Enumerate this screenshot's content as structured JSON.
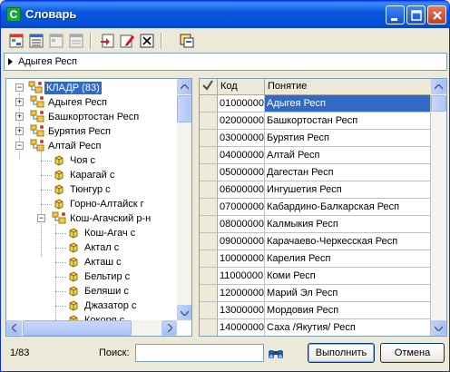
{
  "window": {
    "title": "Словарь"
  },
  "toolbar": {
    "buttons": [
      "tree-add-icon",
      "list-icon",
      "tree-disabled-icon",
      "list-disabled-icon",
      "import-icon",
      "edit-icon",
      "close-box-icon",
      "select-icon"
    ]
  },
  "path": {
    "text": "Адыгея Респ"
  },
  "tree": {
    "root": {
      "label": "КЛАДР (83)"
    },
    "items": [
      {
        "label": "Адыгея Респ",
        "level": 1,
        "expander": "+"
      },
      {
        "label": "Башкортостан Респ",
        "level": 1,
        "expander": "+"
      },
      {
        "label": "Бурятия Респ",
        "level": 1,
        "expander": "+"
      },
      {
        "label": "Алтай Респ",
        "level": 1,
        "expander": "−"
      },
      {
        "label": "Чоя с",
        "level": 2
      },
      {
        "label": "Карагай с",
        "level": 2
      },
      {
        "label": "Тюнгур с",
        "level": 2
      },
      {
        "label": "Горно-Алтайск г",
        "level": 2
      },
      {
        "label": "Кош-Агачский р-н",
        "level": 2,
        "expander": "−"
      },
      {
        "label": "Кош-Агач с",
        "level": 3
      },
      {
        "label": "Актал с",
        "level": 3
      },
      {
        "label": "Акташ с",
        "level": 3
      },
      {
        "label": "Бельтир с",
        "level": 3
      },
      {
        "label": "Беляши с",
        "level": 3
      },
      {
        "label": "Джазатор с",
        "level": 3
      },
      {
        "label": "Кокоря с",
        "level": 3
      }
    ]
  },
  "grid": {
    "columns": [
      "Код",
      "Понятие"
    ],
    "rows": [
      {
        "code": "01000000",
        "name": "Адыгея Респ"
      },
      {
        "code": "02000000",
        "name": "Башкортостан Респ"
      },
      {
        "code": "03000000",
        "name": "Бурятия Респ"
      },
      {
        "code": "04000000",
        "name": "Алтай Респ"
      },
      {
        "code": "05000000",
        "name": "Дагестан Респ"
      },
      {
        "code": "06000000",
        "name": "Ингушетия Респ"
      },
      {
        "code": "07000000",
        "name": "Кабардино-Балкарская Респ"
      },
      {
        "code": "08000000",
        "name": "Калмыкия Респ"
      },
      {
        "code": "09000000",
        "name": "Карачаево-Черкесская Респ"
      },
      {
        "code": "10000000",
        "name": "Карелия Респ"
      },
      {
        "code": "11000000",
        "name": "Коми Респ"
      },
      {
        "code": "12000000",
        "name": "Марий Эл Респ"
      },
      {
        "code": "13000000",
        "name": "Мордовия Респ"
      },
      {
        "code": "14000000",
        "name": "Саха /Якутия/ Респ"
      }
    ]
  },
  "status": {
    "count": "1/83"
  },
  "search": {
    "label": "Поиск:",
    "value": "",
    "placeholder": ""
  },
  "buttons": {
    "execute": "Выполнить",
    "cancel": "Отмена"
  },
  "colors": {
    "selection": "#316ac5",
    "titlebar": "#0a58e0"
  }
}
